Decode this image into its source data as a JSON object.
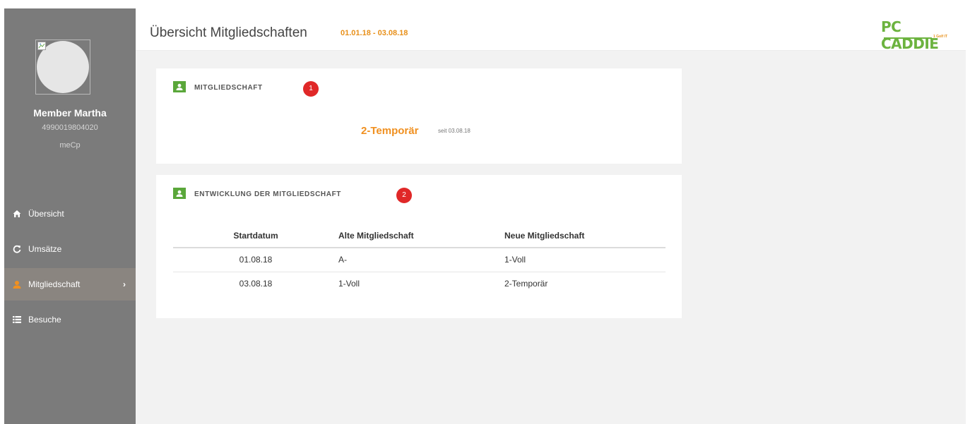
{
  "member": {
    "name": "Member Martha",
    "id": "4990019804020",
    "club": "meCp"
  },
  "sidebar": {
    "items": [
      {
        "label": "Übersicht",
        "icon": "home-icon"
      },
      {
        "label": "Umsätze",
        "icon": "refresh-icon"
      },
      {
        "label": "Mitgliedschaft",
        "icon": "user-icon",
        "active": true
      },
      {
        "label": "Besuche",
        "icon": "list-icon"
      }
    ]
  },
  "header": {
    "title": "Übersicht Mitgliedschaften",
    "date_range": "01.01.18 - 03.08.18",
    "logo_text": "PC CADDIE",
    "logo_sub": "1 Golf IT"
  },
  "membership": {
    "title": "MITGLIEDSCHAFT",
    "badge": "1",
    "value": "2-Temporär",
    "since": "seit 03.08.18"
  },
  "history": {
    "title": "ENTWICKLUNG DER MITGLIEDSCHAFT",
    "badge": "2",
    "columns": [
      "Startdatum",
      "Alte Mitgliedschaft",
      "Neue Mitgliedschaft"
    ],
    "rows": [
      [
        "01.08.18",
        "A-",
        "1-Voll"
      ],
      [
        "03.08.18",
        "1-Voll",
        "2-Temporär"
      ]
    ]
  },
  "colors": {
    "sidebar_bg": "#7b7b7b",
    "accent_orange": "#e8901a",
    "accent_green": "#5aa73a",
    "badge_red": "#e02828"
  }
}
